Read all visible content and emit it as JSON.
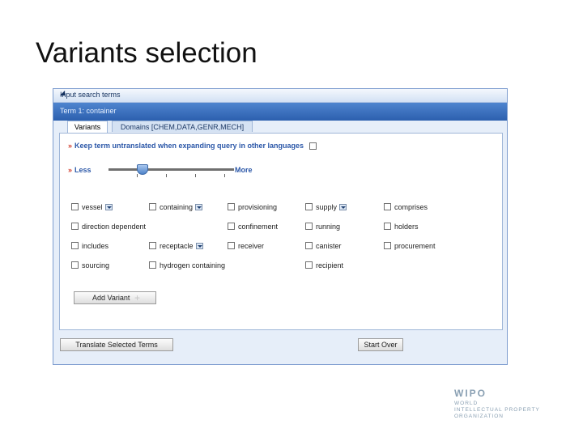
{
  "slide": {
    "title": "Variants selection"
  },
  "panel": {
    "header": "Input search terms",
    "term_header": "Term 1: container",
    "tabs": [
      {
        "label": "Variants",
        "active": true
      },
      {
        "label": "Domains [CHEM,DATA,GENR,MECH]",
        "active": false
      }
    ],
    "keep_untranslated_label": "Keep term untranslated when expanding query in other languages",
    "slider": {
      "less_label": "Less",
      "more_label": "More",
      "value_fraction": 0.27
    },
    "variants": [
      {
        "label": "vessel",
        "dropdown": true
      },
      {
        "label": "containing",
        "dropdown": true
      },
      {
        "label": "provisioning",
        "dropdown": false
      },
      {
        "label": "supply",
        "dropdown": true
      },
      {
        "label": "comprises",
        "dropdown": false
      },
      {
        "label": "direction dependent",
        "dropdown": false
      },
      {
        "label": "confinement",
        "dropdown": false
      },
      {
        "label": "running",
        "dropdown": false
      },
      {
        "label": "holders",
        "dropdown": false
      },
      {
        "label": "includes",
        "dropdown": false
      },
      {
        "label": "receptacle",
        "dropdown": true
      },
      {
        "label": "receiver",
        "dropdown": false
      },
      {
        "label": "canister",
        "dropdown": false
      },
      {
        "label": "procurement",
        "dropdown": false
      },
      {
        "label": "sourcing",
        "dropdown": false
      },
      {
        "label": "hydrogen containing",
        "dropdown": false
      },
      {
        "label": "recipient",
        "dropdown": false
      }
    ],
    "add_variant_label": "Add Variant",
    "add_icon": "+",
    "translate_label": "Translate Selected Terms",
    "start_over_label": "Start Over"
  },
  "logo": {
    "main": "WIPO",
    "lines": [
      "WORLD",
      "INTELLECTUAL PROPERTY",
      "ORGANIZATION"
    ]
  },
  "colors": {
    "header_blue": "#2c5fae",
    "link_blue": "#2b57a8",
    "arrow_red": "#d03a2a"
  }
}
